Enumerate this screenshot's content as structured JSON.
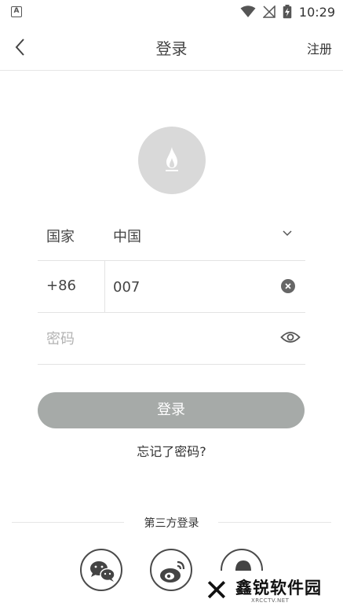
{
  "status_bar": {
    "time": "10:29",
    "app_badge": "A"
  },
  "header": {
    "title": "登录",
    "register_label": "注册"
  },
  "form": {
    "country_label": "国家",
    "country_value": "中国",
    "phone_code": "+86",
    "phone_value": "007",
    "password_placeholder": "密码"
  },
  "login_button_label": "登录",
  "forgot_password_label": "忘记了密码?",
  "third_party": {
    "title": "第三方登录",
    "providers": [
      "wechat",
      "weibo",
      "qq"
    ]
  },
  "watermark": {
    "brand": "鑫锐软件园",
    "site": "XRCCTV.NET"
  },
  "colors": {
    "button_bg": "#a6aaa8",
    "avatar_bg": "#d9d9d9",
    "divider": "#e3e3e3"
  },
  "icons": {
    "back": "chevron-left-icon",
    "avatar": "flame-icon",
    "country_dropdown": "chevron-down-icon",
    "clear": "clear-circle-icon",
    "password_toggle": "eye-icon"
  }
}
